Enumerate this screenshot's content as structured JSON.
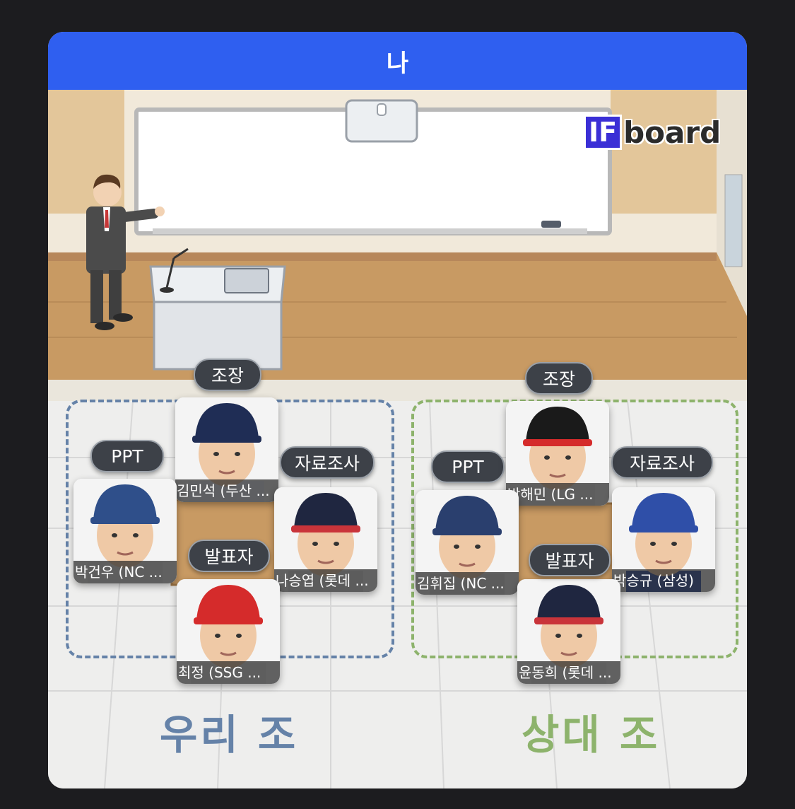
{
  "modal": {
    "title": "나"
  },
  "brand": {
    "badge": "IF",
    "word": "board"
  },
  "teams": {
    "ours": {
      "title": "우리 조",
      "color": "#6582a8"
    },
    "theirs": {
      "title": "상대 조",
      "color": "#8db36c"
    }
  },
  "roles": {
    "leader": "조장",
    "ppt": "PPT",
    "research": "자료조사",
    "presenter": "발표자"
  },
  "players": {
    "ours": {
      "leader": {
        "name": "김민석 (두산 ...",
        "cap": "#1f2d55"
      },
      "ppt": {
        "name": "박건우 (NC ...",
        "cap": "#2f4f8a"
      },
      "research": {
        "name": "나승엽 (롯데 ...",
        "cap": "#1f2640"
      },
      "presenter": {
        "name": "최정 (SSG ...",
        "cap": "#d52b2b"
      }
    },
    "theirs": {
      "leader": {
        "name": "박해민 (LG ...",
        "cap": "#1a1a1a"
      },
      "ppt": {
        "name": "김휘집 (NC ...",
        "cap": "#2a3f6e"
      },
      "research": {
        "name": "박승규 (삼성)",
        "cap": "#2f4fa8"
      },
      "presenter": {
        "name": "윤동희 (롯데 ...",
        "cap": "#1f2640"
      }
    }
  },
  "colors": {
    "header": "#2f5ff0",
    "role_chip": "#3d4148"
  }
}
